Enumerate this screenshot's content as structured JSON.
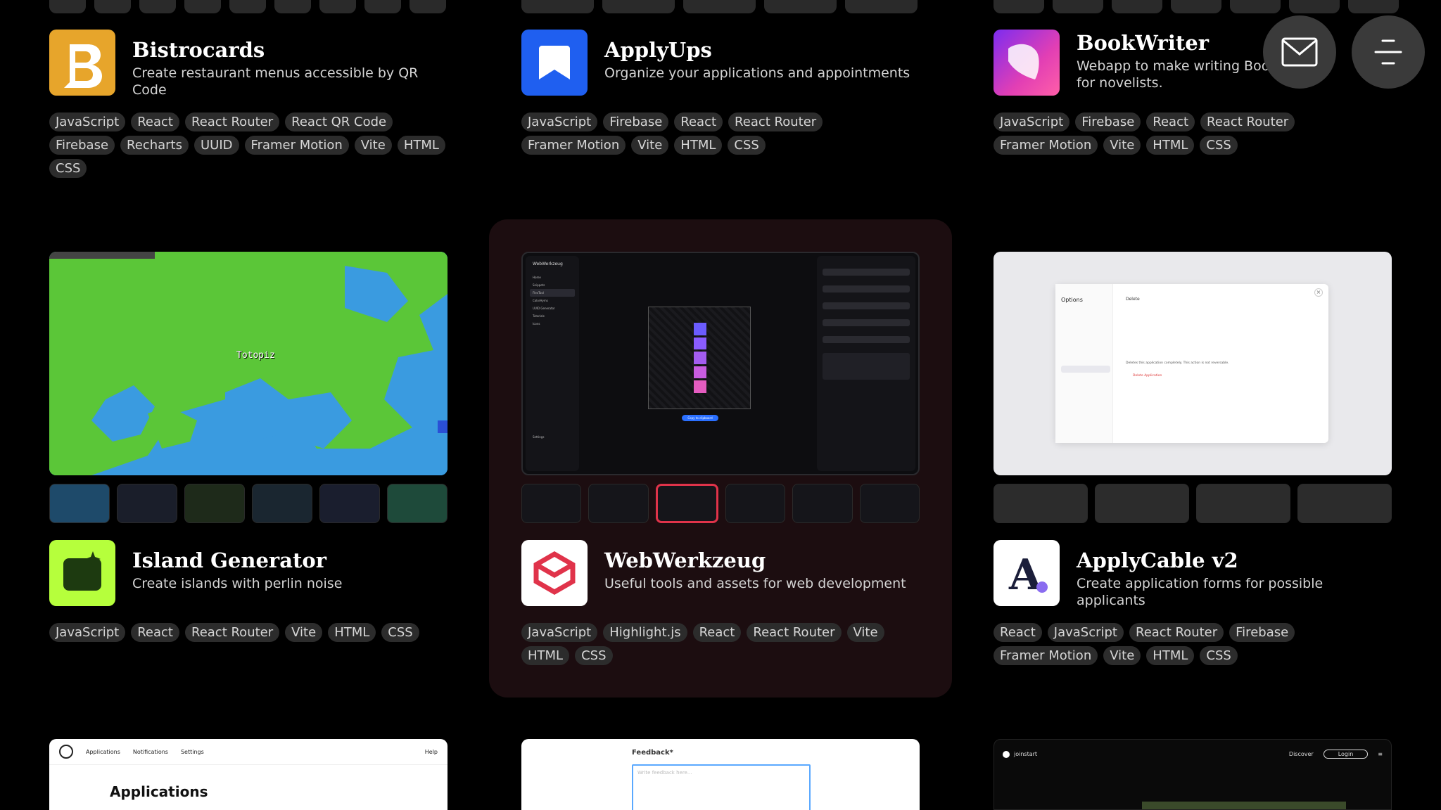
{
  "projects": [
    {
      "title": "Bistrocards",
      "desc": "Create restaurant menus accessible by QR Code",
      "logo_bg": "#e7a52b",
      "tags": [
        "JavaScript",
        "React",
        "React Router",
        "React QR Code",
        "Firebase",
        "Recharts",
        "UUID",
        "Framer Motion",
        "Vite",
        "HTML",
        "CSS"
      ]
    },
    {
      "title": "ApplyUps",
      "desc": "Organize your applications and appointments",
      "logo_bg": "#1f5ff0",
      "tags": [
        "JavaScript",
        "Firebase",
        "React",
        "React Router",
        "Framer Motion",
        "Vite",
        "HTML",
        "CSS"
      ]
    },
    {
      "title": "BookWriter",
      "desc": "Webapp to make writing Books easier for novelists.",
      "logo_bg": "#e23fb4",
      "tags": [
        "JavaScript",
        "Firebase",
        "React",
        "React Router",
        "Framer Motion",
        "Vite",
        "HTML",
        "CSS"
      ]
    },
    {
      "title": "Island Generator",
      "desc": "Create islands with perlin noise",
      "logo_bg": "#b6ff3c",
      "tags": [
        "JavaScript",
        "React",
        "React Router",
        "Vite",
        "HTML",
        "CSS"
      ],
      "map_label": "Totopiz"
    },
    {
      "title": "WebWerkzeug",
      "desc": "Useful tools and assets for web development",
      "logo_bg": "#ffffff",
      "tags": [
        "JavaScript",
        "Highlight.js",
        "React",
        "React Router",
        "Vite",
        "HTML",
        "CSS"
      ],
      "app_name": "WebWerkzeug",
      "nav": [
        "Home",
        "Snippets",
        "FlexTool",
        "ColorHyms",
        "UUID Generator",
        "Tutorials",
        "Icons",
        "Settings"
      ],
      "copy_btn": "Copy to clipboard"
    },
    {
      "title": "ApplyCable v2",
      "desc": "Create application forms for possible applicants",
      "logo_bg": "#ffffff",
      "tags": [
        "React",
        "JavaScript",
        "React Router",
        "Firebase",
        "Framer Motion",
        "Vite",
        "HTML",
        "CSS"
      ],
      "modal_title": "Options",
      "modal_heading": "Delete",
      "modal_text": "Deletes this application completely. This action is not reversable.",
      "modal_btn": "Delete Application"
    }
  ],
  "bottom": {
    "apps_tabs": [
      "Applications",
      "Notifications",
      "Settings"
    ],
    "apps_help": "Help",
    "apps_heading": "Applications",
    "feedback_label": "Feedback*",
    "feedback_placeholder": "Write feedback here...",
    "joinstart_brand": "joinstart",
    "joinstart_discover": "Discover",
    "joinstart_login": "Login"
  },
  "fabs": {
    "mail": "mail-icon",
    "menu": "menu-icon"
  }
}
